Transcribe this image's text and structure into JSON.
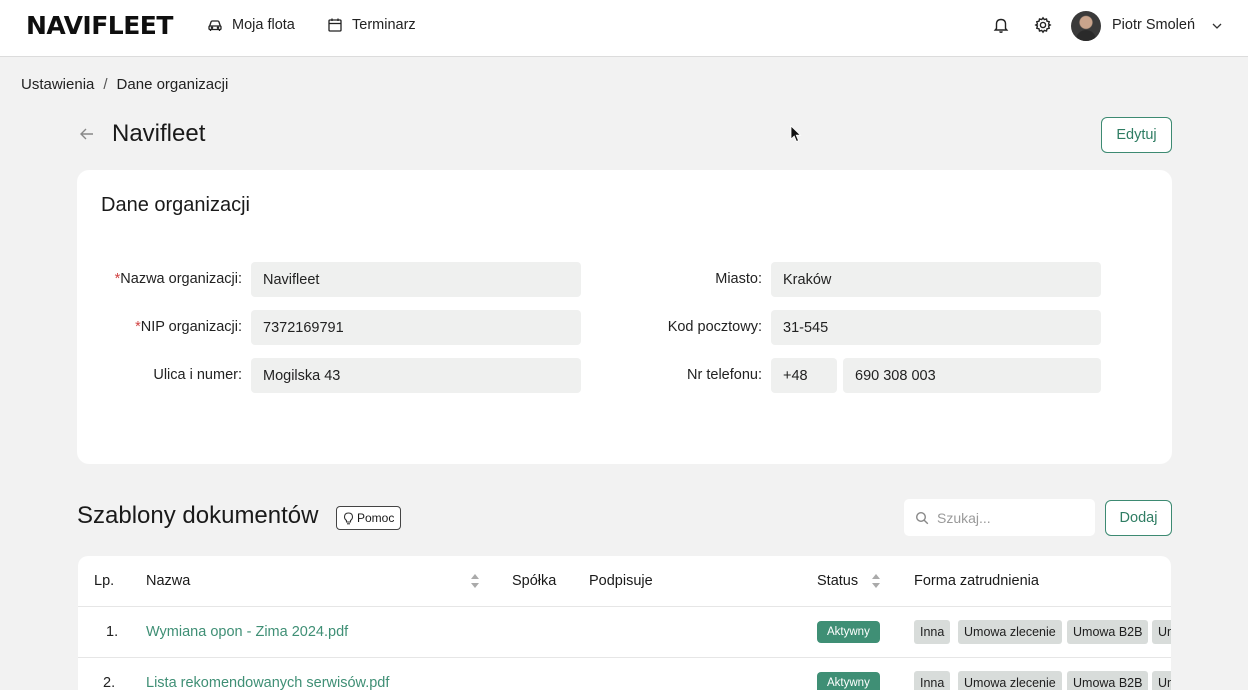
{
  "header": {
    "logo": "NAVIFLEET",
    "nav": [
      {
        "label": "Moja flota",
        "icon": "car-icon"
      },
      {
        "label": "Terminarz",
        "icon": "calendar-icon"
      }
    ],
    "user_name": "Piotr Smoleń"
  },
  "breadcrumb": {
    "root": "Ustawienia",
    "separator": "/",
    "current": "Dane organizacji"
  },
  "page": {
    "title": "Navifleet",
    "edit_label": "Edytuj"
  },
  "org_card": {
    "title": "Dane organizacji",
    "required_mark": "*",
    "fields": {
      "name": {
        "label": "Nazwa organizacji:",
        "value": "Navifleet"
      },
      "nip": {
        "label": "NIP organizacji:",
        "value": "7372169791"
      },
      "street": {
        "label": "Ulica i numer:",
        "value": "Mogilska 43"
      },
      "city": {
        "label": "Miasto:",
        "value": "Kraków"
      },
      "postal": {
        "label": "Kod pocztowy:",
        "value": "31-545"
      },
      "phone": {
        "label": "Nr telefonu:",
        "prefix": "+48",
        "value": "690 308 003"
      }
    }
  },
  "templates": {
    "title": "Szablony dokumentów",
    "help_label": "Pomoc",
    "search_placeholder": "Szukaj...",
    "add_label": "Dodaj",
    "columns": {
      "lp": "Lp.",
      "name": "Nazwa",
      "company": "Spółka",
      "signs": "Podpisuje",
      "status": "Status",
      "employment": "Forma zatrudnienia"
    },
    "rows": [
      {
        "lp": "1.",
        "name": "Wymiana opon - Zima 2024.pdf",
        "status": "Aktywny",
        "tags": [
          "Inna",
          "Umowa zlecenie",
          "Umowa B2B",
          "Um"
        ]
      },
      {
        "lp": "2.",
        "name": "Lista rekomendowanych serwisów.pdf",
        "status": "Aktywny",
        "tags": [
          "Inna",
          "Umowa zlecenie",
          "Umowa B2B",
          "Um"
        ]
      }
    ]
  },
  "colors": {
    "accent": "#3f8f75",
    "background": "#f2f2f2",
    "field": "#eff0ef",
    "required": "#d14343"
  }
}
